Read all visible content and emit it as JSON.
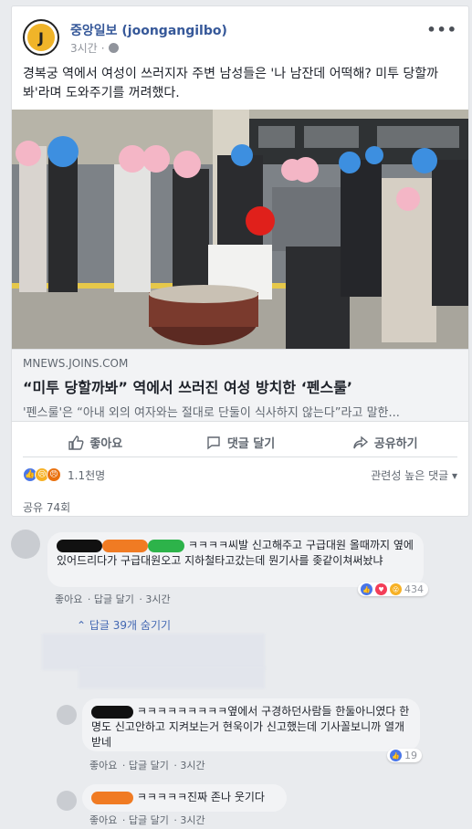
{
  "post": {
    "page_name": "중앙일보 (joongangilbo)",
    "avatar_letter": "J",
    "time": "3시간",
    "more_icon": "more-horizontal-icon",
    "text": "경복궁 역에서 여성이 쓰러지자 주변 남성들은 '나 남잔데 어떡해? 미투 당할까 봐'라며 도와주기를 꺼려했다.",
    "link": {
      "domain": "MNEWS.JOINS.COM",
      "title": "“미투 당할까봐” 역에서 쓰러진 여성 방치한 ‘펜스룰’",
      "description": "'펜스룰'은 “아내 외의 여자와는 절대로 단둘이 식사하지 않는다”라고 말한..."
    },
    "actions": {
      "like": "좋아요",
      "comment": "댓글 달기",
      "share": "공유하기"
    },
    "reaction_count": "1.1천명",
    "sort": "관련성 높은 댓글 ▾",
    "share_count": "공유 74회"
  },
  "comments": [
    {
      "text": "ㅋㅋㅋㅋ씨발 신고해주고 구급대원 올때까지 옆에있어드리다가 구급대원오고 지하철타고갔는데 뭔기사를 좆같이쳐써놨냐",
      "actions": {
        "like": "좋아요",
        "reply": "답글 달기",
        "time": "3시간"
      },
      "reaction_count": "434"
    }
  ],
  "hide_replies": "답글 39개 숨기기",
  "replies": [
    {
      "text": "ㅋㅋㅋㅋㅋㅋㅋㅋㅋ옆에서 구경하던사람들 한둘아니였다 한명도 신고안하고 지켜보는거 현욱이가 신고했는데 기사꼴보니까 열개받네",
      "actions": {
        "like": "좋아요",
        "reply": "답글 달기",
        "time": "3시간"
      },
      "reaction_count": "19"
    },
    {
      "text": "ㅋㅋㅋㅋㅋ진짜 존나 웃기다",
      "actions": {
        "like": "좋아요",
        "reply": "답글 달기",
        "time": "3시간"
      }
    }
  ],
  "colors": {
    "link_blue": "#365899",
    "like_blue": "#4a76e8",
    "bg": "#e9ebee"
  }
}
